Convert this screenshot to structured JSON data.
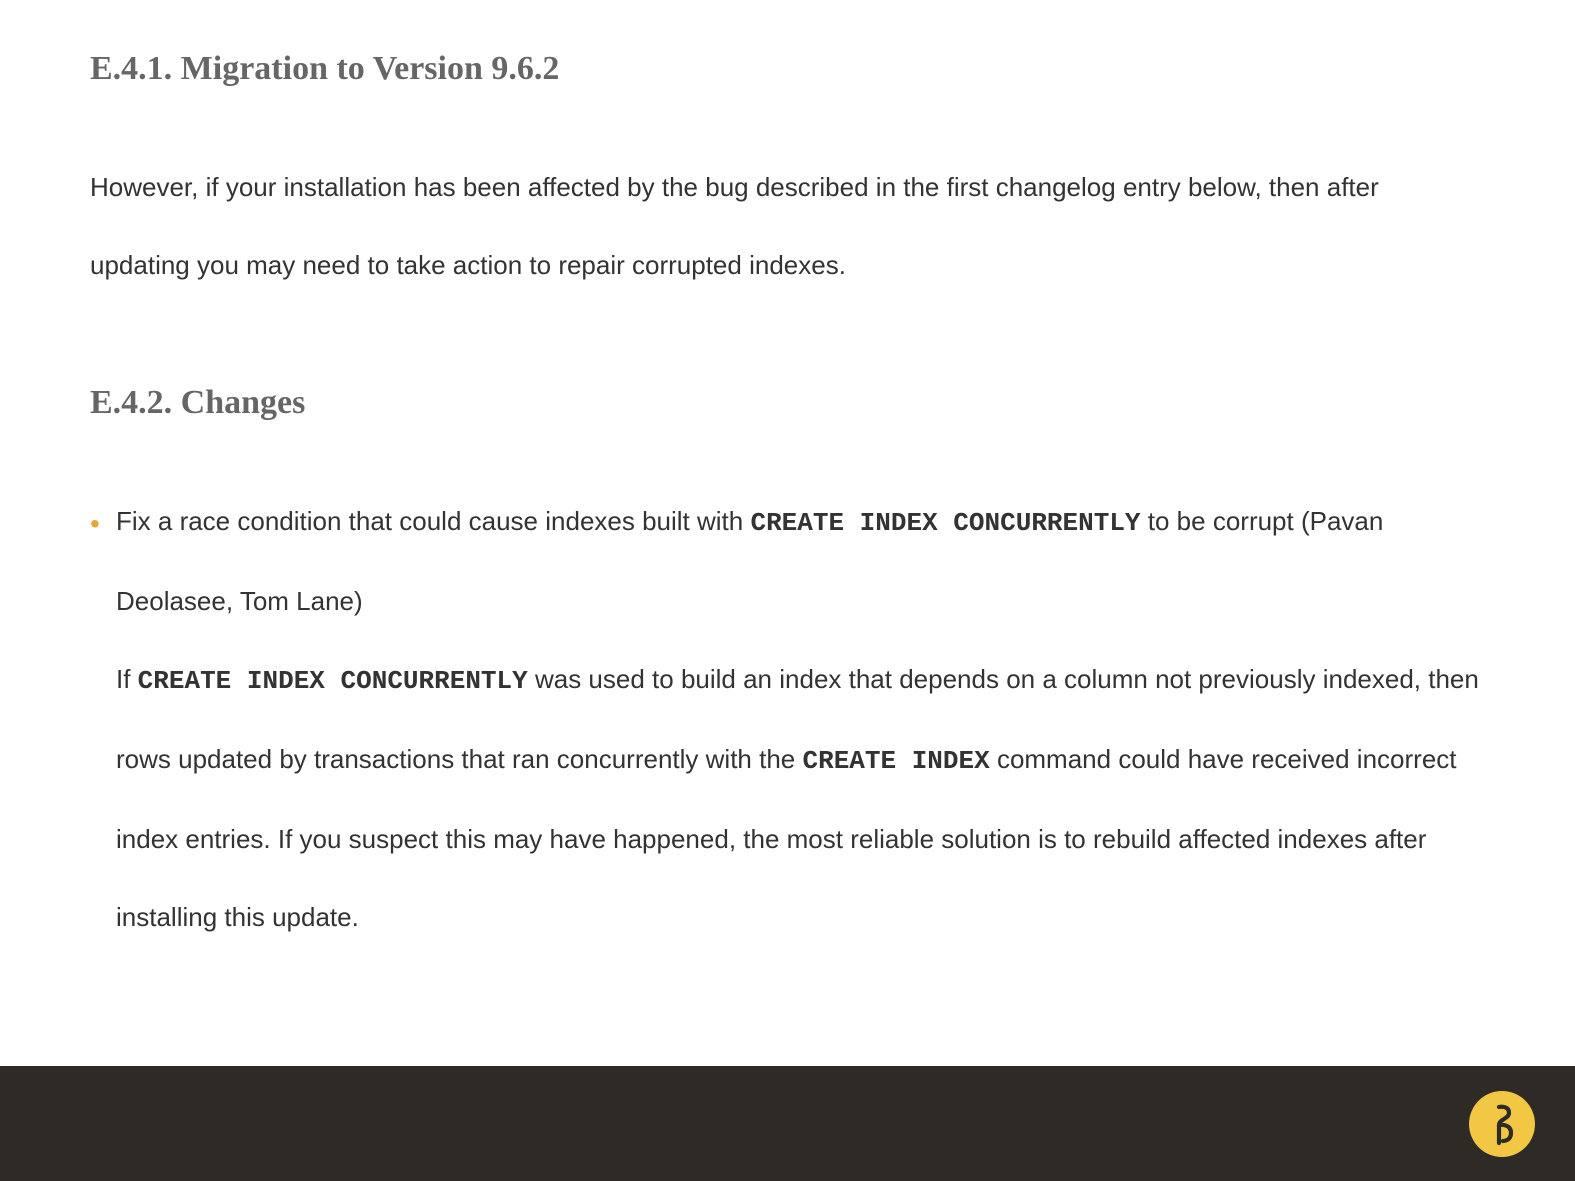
{
  "sections": {
    "migration": {
      "heading": "E.4.1. Migration to Version 9.6.2",
      "paragraph": "However, if your installation has been affected by the bug described in the first changelog entry below, then after updating you may need to take action to repair corrupted indexes."
    },
    "changes": {
      "heading": "E.4.2. Changes",
      "item": {
        "lead_pre": "Fix a race condition that could cause indexes built with ",
        "lead_code": "CREATE INDEX CONCURRENTLY",
        "lead_post": " to be corrupt (Pavan Deolasee, Tom Lane)",
        "body_pre": "If ",
        "body_code1": "CREATE INDEX CONCURRENTLY",
        "body_mid1": " was used to build an index that depends on a column not previously indexed, then rows updated by transactions that ran concurrently with the ",
        "body_code2": "CREATE INDEX",
        "body_mid2": " command could have received incorrect index entries. If you suspect this may have happened, the most reliable solution is to rebuild affected indexes after installing this update."
      }
    }
  }
}
